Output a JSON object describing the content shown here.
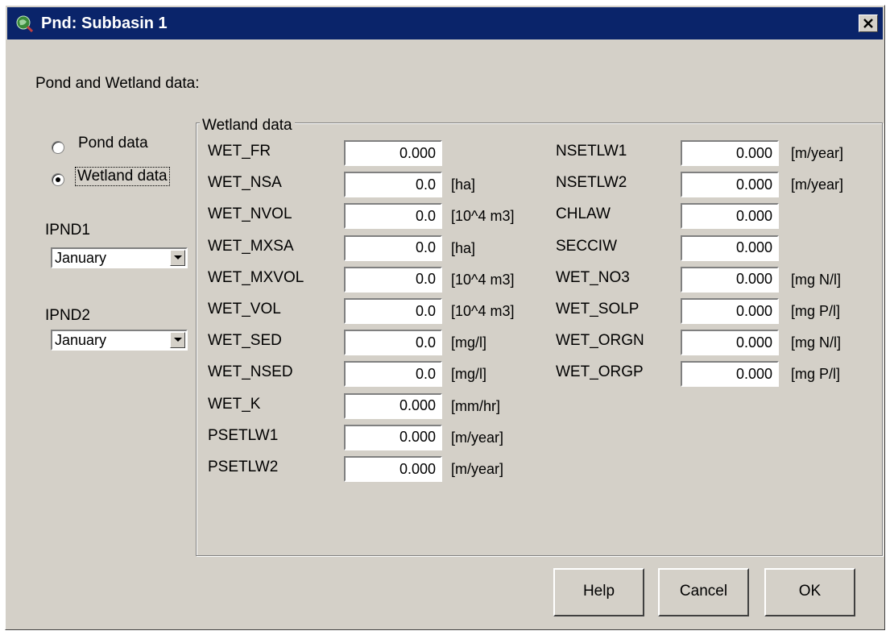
{
  "window": {
    "title": "Pnd: Subbasin 1",
    "close_icon": "close-icon",
    "app_icon": "globe-icon"
  },
  "section_label": "Pond and Wetland data:",
  "data_type": {
    "options": [
      {
        "label": "Pond data",
        "selected": false
      },
      {
        "label": "Wetland data",
        "selected": true
      }
    ]
  },
  "ipnd1": {
    "label": "IPND1",
    "value": "January"
  },
  "ipnd2": {
    "label": "IPND2",
    "value": "January"
  },
  "group": {
    "title": "Wetland data"
  },
  "params_left": [
    {
      "name": "WET_FR",
      "value": "0.000",
      "unit": ""
    },
    {
      "name": "WET_NSA",
      "value": "0.0",
      "unit": "[ha]"
    },
    {
      "name": "WET_NVOL",
      "value": "0.0",
      "unit": "[10^4 m3]"
    },
    {
      "name": "WET_MXSA",
      "value": "0.0",
      "unit": "[ha]"
    },
    {
      "name": "WET_MXVOL",
      "value": "0.0",
      "unit": "[10^4 m3]"
    },
    {
      "name": "WET_VOL",
      "value": "0.0",
      "unit": "[10^4 m3]"
    },
    {
      "name": "WET_SED",
      "value": "0.0",
      "unit": "[mg/l]"
    },
    {
      "name": "WET_NSED",
      "value": "0.0",
      "unit": "[mg/l]"
    },
    {
      "name": "WET_K",
      "value": "0.000",
      "unit": "[mm/hr]"
    },
    {
      "name": "PSETLW1",
      "value": "0.000",
      "unit": "[m/year]"
    },
    {
      "name": "PSETLW2",
      "value": "0.000",
      "unit": "[m/year]"
    }
  ],
  "params_right": [
    {
      "name": "NSETLW1",
      "value": "0.000",
      "unit": "[m/year]"
    },
    {
      "name": "NSETLW2",
      "value": "0.000",
      "unit": "[m/year]"
    },
    {
      "name": "CHLAW",
      "value": "0.000",
      "unit": ""
    },
    {
      "name": "SECCIW",
      "value": "0.000",
      "unit": ""
    },
    {
      "name": "WET_NO3",
      "value": "0.000",
      "unit": "[mg N/l]"
    },
    {
      "name": "WET_SOLP",
      "value": "0.000",
      "unit": "[mg P/l]"
    },
    {
      "name": "WET_ORGN",
      "value": "0.000",
      "unit": "[mg N/l]"
    },
    {
      "name": "WET_ORGP",
      "value": "0.000",
      "unit": "[mg P/l]"
    }
  ],
  "buttons": {
    "help": "Help",
    "cancel": "Cancel",
    "ok": "OK"
  }
}
